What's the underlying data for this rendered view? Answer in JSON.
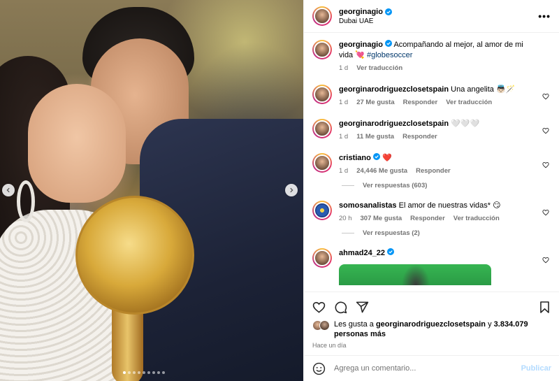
{
  "photo": {
    "slide_count": 9,
    "active_slide": 1
  },
  "post": {
    "author": "georginagio",
    "location": "Dubai UAE",
    "more_icon": "more-options-icon"
  },
  "caption": {
    "username": "georginagio",
    "text": "Acompañando al mejor, al amor de mi vida 💘",
    "hashtag": "#globesoccer",
    "time": "1 d",
    "translate": "Ver traducción"
  },
  "comments": [
    {
      "username": "georginarodriguezclosetspain",
      "text": "Una angelita 👼🏻🪄",
      "time": "1 d",
      "likes": "27 Me gusta",
      "reply": "Responder",
      "translate": "Ver traducción"
    },
    {
      "username": "georginarodriguezclosetspain",
      "text": "🤍🤍🤍",
      "time": "1 d",
      "likes": "11 Me gusta",
      "reply": "Responder"
    },
    {
      "username": "cristiano",
      "text": "❤️",
      "time": "1 d",
      "likes": "24,446 Me gusta",
      "reply": "Responder",
      "view_replies": "Ver respuestas (603)"
    },
    {
      "username": "somosanalistas",
      "text": "El amor de nuestras vidas* 😏",
      "time": "20 h",
      "likes": "307 Me gusta",
      "reply": "Responder",
      "translate": "Ver traducción",
      "view_replies": "Ver respuestas (2)"
    },
    {
      "username": "ahmad24_22"
    }
  ],
  "likes": {
    "prefix": "Les gusta a",
    "user": "georginarodriguezclosetspain",
    "joiner": "y",
    "count": "3.834.079 personas más"
  },
  "posted_ago": "Hace un día",
  "comment_box": {
    "placeholder": "Agrega un comentario...",
    "publish": "Publicar"
  },
  "colors": {
    "link": "#00376b",
    "muted": "#737373",
    "verified": "#0095f6",
    "publish_disabled": "#b3dbff"
  }
}
